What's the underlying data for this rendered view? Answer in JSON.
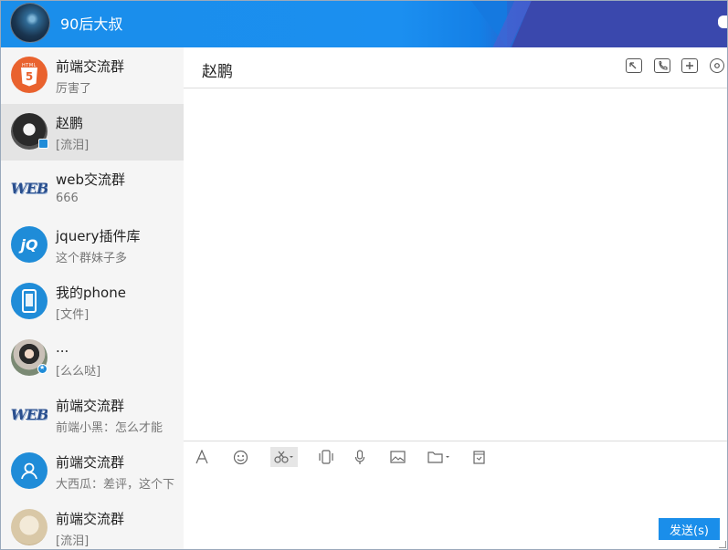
{
  "title_bar": {
    "user_name": "90后大叔"
  },
  "sidebar": {
    "conversations": [
      {
        "name": "前端交流群",
        "last_message": "厉害了",
        "avatar": "html5-icon"
      },
      {
        "name": "赵鹏",
        "last_message": "[流泪]",
        "avatar": "person-avatar",
        "active": true
      },
      {
        "name": "web交流群",
        "last_message": "666",
        "avatar": "web-logo-icon"
      },
      {
        "name": "jquery插件库",
        "last_message": "这个群妹子多",
        "avatar": "jquery-icon"
      },
      {
        "name": "我的phone",
        "last_message": "[文件]",
        "avatar": "phone-icon"
      },
      {
        "name": "...",
        "last_message": "[么么哒]",
        "avatar": "girl-avatar"
      },
      {
        "name": "前端交流群",
        "last_message": "前端小黑：怎么才能",
        "avatar": "web-logo-icon"
      },
      {
        "name": "前端交流群",
        "last_message": "大西瓜：差评，这个下",
        "avatar": "contact-icon"
      },
      {
        "name": "前端交流群",
        "last_message": "[流泪]",
        "avatar": "beige-avatar"
      }
    ]
  },
  "chat": {
    "title": "赵鹏",
    "header_icons": [
      "screen-share-icon",
      "phone-icon",
      "add-icon",
      "settings-icon"
    ]
  },
  "toolbar": {
    "tools": [
      "font-icon",
      "emoji-icon",
      "scissors-icon",
      "shake-icon",
      "microphone-icon",
      "image-icon",
      "folder-icon",
      "document-icon"
    ],
    "send_label": "发送(s)"
  },
  "colors": {
    "accent": "#1a8eea",
    "sidebar_bg": "#f5f5f5",
    "active_row": "#e4e4e4"
  }
}
